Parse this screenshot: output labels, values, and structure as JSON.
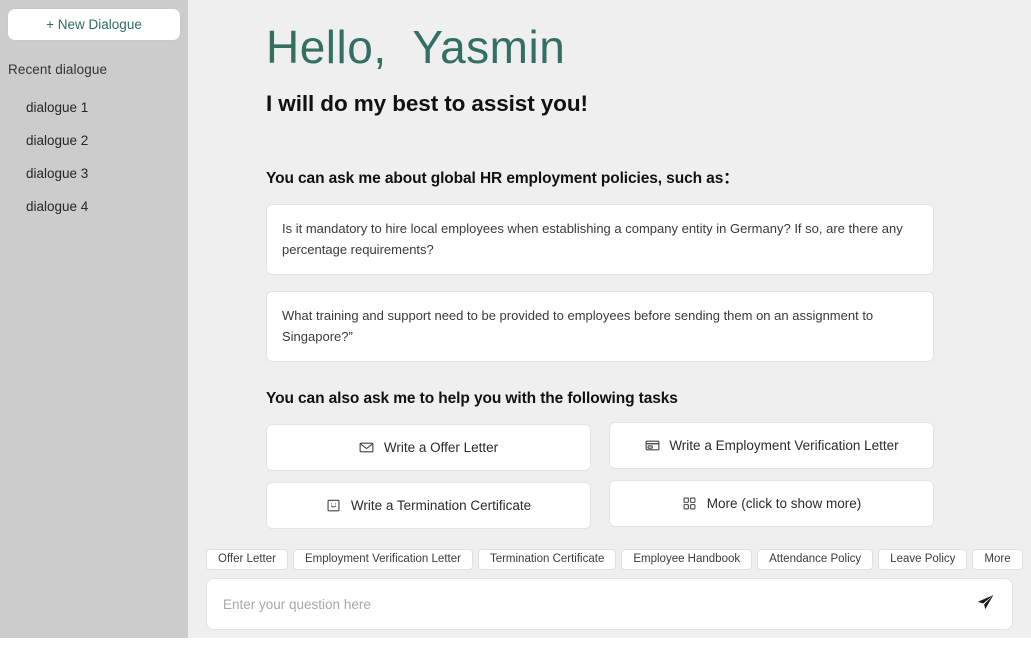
{
  "sidebar": {
    "new_dialogue_label": "+ New Dialogue",
    "recent_label": "Recent dialogue",
    "items": [
      {
        "label": "dialogue 1"
      },
      {
        "label": "dialogue 2"
      },
      {
        "label": "dialogue 3"
      },
      {
        "label": "dialogue 4"
      }
    ]
  },
  "main": {
    "greeting": "Hello,  Yasmin",
    "subtitle": "I will do my best to assist you!",
    "ask_heading": "You can ask me about global HR employment policies, such as：",
    "tasks_heading": "You can also ask me to help you with the following tasks",
    "sample_questions": [
      {
        "text": "Is it mandatory to hire local employees when establishing a company entity in Germany? If so, are there any percentage requirements?"
      },
      {
        "text": "What training and support need to be provided to employees before sending them on an assignment to Singapore?”"
      }
    ],
    "tasks": [
      {
        "label": "Write a Offer Letter",
        "icon": "mail-icon"
      },
      {
        "label": "Write a Employment Verification Letter",
        "icon": "card-icon"
      },
      {
        "label": "Write a Termination Certificate",
        "icon": "certificate-icon"
      },
      {
        "label": "More  (click to show more)",
        "icon": "grid-icon"
      }
    ]
  },
  "bottom": {
    "chips": [
      {
        "label": "Offer Letter"
      },
      {
        "label": "Employment Verification Letter"
      },
      {
        "label": "Termination Certificate"
      },
      {
        "label": "Employee Handbook"
      },
      {
        "label": "Attendance Policy"
      },
      {
        "label": "Leave Policy"
      },
      {
        "label": "More"
      }
    ],
    "input_placeholder": "Enter your question here",
    "input_value": "",
    "send_icon": "send-paper-plane-icon"
  },
  "colors": {
    "accent_teal": "#337063",
    "sidebar_bg": "#cccccc",
    "main_bg": "#efefef",
    "card_bg": "#ffffff"
  }
}
